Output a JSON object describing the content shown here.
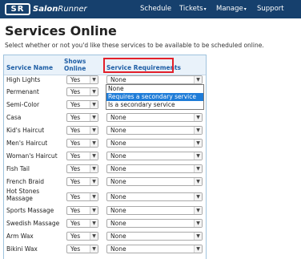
{
  "nav": {
    "logo_mark": "SR",
    "logo_name_bold": "Salon",
    "logo_name_rest": "Runner",
    "items": [
      "Schedule",
      "Tickets",
      "Manage",
      "Support"
    ],
    "caret": "▾"
  },
  "page": {
    "title": "Services Online",
    "subtitle": "Select whether or not you'd like these services to be available to be scheduled online."
  },
  "table": {
    "headers": [
      "Service Name",
      "Shows Online",
      "Service Requirements"
    ],
    "rows": [
      {
        "name": "High Lights",
        "shows": "Yes",
        "req": "None"
      },
      {
        "name": "Permenant",
        "shows": "Yes",
        "req": "None"
      },
      {
        "name": "Semi-Color",
        "shows": "Yes",
        "req": "None"
      },
      {
        "name": "Casa",
        "shows": "Yes",
        "req": "None"
      },
      {
        "name": "Kid's Haircut",
        "shows": "Yes",
        "req": "None"
      },
      {
        "name": "Men's Haircut",
        "shows": "Yes",
        "req": "None"
      },
      {
        "name": "Woman's Haircut",
        "shows": "Yes",
        "req": "None"
      },
      {
        "name": "Fish Tail",
        "shows": "Yes",
        "req": "None"
      },
      {
        "name": "French Braid",
        "shows": "Yes",
        "req": "None"
      },
      {
        "name": "Hot Stones Massage",
        "shows": "Yes",
        "req": "None"
      },
      {
        "name": "Sports Massage",
        "shows": "Yes",
        "req": "None"
      },
      {
        "name": "Swedish Massage",
        "shows": "Yes",
        "req": "None"
      },
      {
        "name": "Arm Wax",
        "shows": "Yes",
        "req": "None"
      },
      {
        "name": "Bikini Wax",
        "shows": "Yes",
        "req": "None"
      }
    ]
  },
  "dropdown": {
    "options": [
      "None",
      "Requires a secondary service",
      "Is a secondary service"
    ],
    "highlighted": "Requires a secondary service"
  },
  "icons": {
    "select_arrow": "chevron-down-icon"
  },
  "colors": {
    "nav_bg": "#16406d",
    "header_text": "#1f5fa6",
    "highlight_border": "#e3202a",
    "selected_option": "#1e7cd8"
  }
}
